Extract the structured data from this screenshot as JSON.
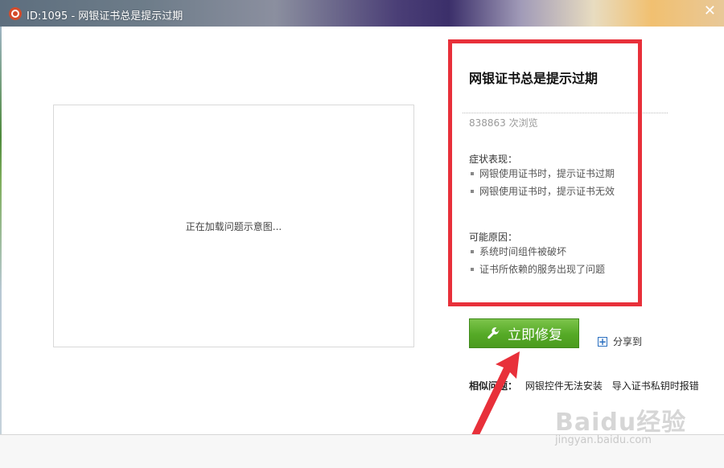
{
  "window": {
    "title": "ID:1095 - 网银证书总是提示过期",
    "close_symbol": "✕"
  },
  "preview": {
    "loading_text": "正在加载问题示意图..."
  },
  "problem": {
    "title": "网银证书总是提示过期",
    "views": "838863 次浏览",
    "symptoms_label": "症状表现：",
    "symptoms": [
      "网银使用证书时，提示证书过期",
      "网银使用证书时，提示证书无效"
    ],
    "causes_label": "可能原因：",
    "causes": [
      "系统时间组件被破坏",
      "证书所依赖的服务出现了问题"
    ]
  },
  "actions": {
    "fix_button": "立即修复",
    "share_plus": "+",
    "share_label": "分享到"
  },
  "related": {
    "label": "相似问题：",
    "links": [
      "网银控件无法安装",
      "导入证书私钥时报错"
    ]
  },
  "watermark": {
    "brand": "Baidu经验",
    "url": "jingyan.baidu.com"
  },
  "colors": {
    "highlight": "#e8303a",
    "fix_button": "#55a926",
    "arrow": "#e8303a"
  }
}
